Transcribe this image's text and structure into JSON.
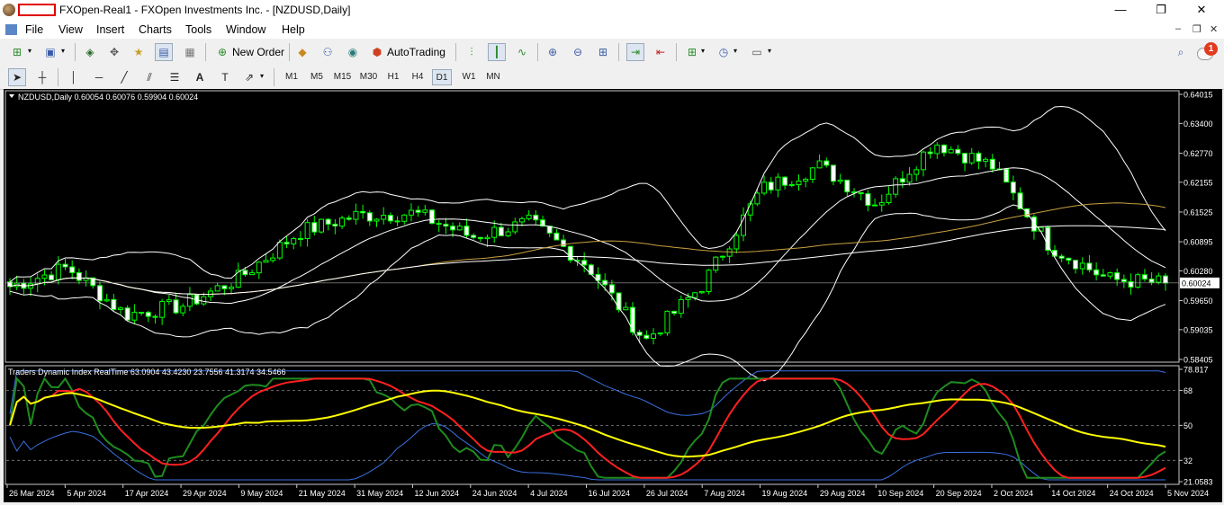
{
  "window": {
    "title": "FXOpen-Real1 - FXOpen Investments Inc. - [NZDUSD,Daily]",
    "controls": [
      "—",
      "❐",
      "✕"
    ]
  },
  "menu": {
    "items": [
      "File",
      "View",
      "Insert",
      "Charts",
      "Tools",
      "Window",
      "Help"
    ],
    "mdi_controls": [
      "–",
      "❐",
      "✕"
    ]
  },
  "toolbar": {
    "new_order_label": "New Order",
    "autotrading_label": "AutoTrading",
    "notification_count": "1"
  },
  "timeframes": [
    "M1",
    "M5",
    "M15",
    "M30",
    "H1",
    "H4",
    "D1",
    "W1",
    "MN"
  ],
  "active_timeframe": "D1",
  "chart": {
    "header": "NZDUSD,Daily  0.60054 0.60076 0.59904 0.60024",
    "current_price": "0.60024",
    "price_ticks": [
      "0.64015",
      "0.63400",
      "0.62770",
      "0.62155",
      "0.61525",
      "0.60895",
      "0.60280",
      "0.59650",
      "0.59035",
      "0.58405"
    ],
    "indicator_header": "Traders Dynamic Index RealTime 63.0904 43.4230 23.7556 41.3174 34.5466",
    "indicator_ticks": [
      "78.817",
      "68",
      "50",
      "32",
      "21.0583"
    ],
    "date_ticks": [
      "26 Mar 2024",
      "5 Apr 2024",
      "17 Apr 2024",
      "29 Apr 2024",
      "9 May 2024",
      "21 May 2024",
      "31 May 2024",
      "12 Jun 2024",
      "24 Jun 2024",
      "4 Jul 2024",
      "16 Jul 2024",
      "26 Jul 2024",
      "7 Aug 2024",
      "19 Aug 2024",
      "29 Aug 2024",
      "10 Sep 2024",
      "20 Sep 2024",
      "2 Oct 2024",
      "14 Oct 2024",
      "24 Oct 2024",
      "5 Nov 2024"
    ],
    "colors": {
      "background": "#000000",
      "candle": "#00ff00",
      "bands": "#ffffff",
      "ma_slow": "#c8a040",
      "tdi_bands": "#3a6fe0",
      "tdi_price": "#1e8c1e",
      "tdi_signal": "#ff2020",
      "tdi_base": "#ffff00"
    }
  },
  "chart_data": {
    "type": "candlestick",
    "symbol": "NZDUSD",
    "timeframe": "Daily",
    "ohlc_last": {
      "open": 0.60054,
      "high": 0.60076,
      "low": 0.59904,
      "close": 0.60024
    },
    "ylim": [
      0.58405,
      0.64015
    ],
    "x": [
      "26 Mar 2024",
      "5 Apr 2024",
      "17 Apr 2024",
      "29 Apr 2024",
      "9 May 2024",
      "21 May 2024",
      "31 May 2024",
      "12 Jun 2024",
      "24 Jun 2024",
      "4 Jul 2024",
      "16 Jul 2024",
      "26 Jul 2024",
      "7 Aug 2024",
      "19 Aug 2024",
      "29 Aug 2024",
      "10 Sep 2024",
      "20 Sep 2024",
      "2 Oct 2024",
      "14 Oct 2024",
      "24 Oct 2024",
      "5 Nov 2024"
    ],
    "close_path": [
      [
        "26 Mar 2024",
        0.5995
      ],
      [
        "5 Apr 2024",
        0.6035
      ],
      [
        "17 Apr 2024",
        0.5935
      ],
      [
        "29 Apr 2024",
        0.5955
      ],
      [
        "9 May 2024",
        0.6015
      ],
      [
        "21 May 2024",
        0.611
      ],
      [
        "31 May 2024",
        0.6145
      ],
      [
        "12 Jun 2024",
        0.615
      ],
      [
        "24 Jun 2024",
        0.61
      ],
      [
        "4 Jul 2024",
        0.613
      ],
      [
        "16 Jul 2024",
        0.604
      ],
      [
        "26 Jul 2024",
        0.588
      ],
      [
        "7 Aug 2024",
        0.6
      ],
      [
        "19 Aug 2024",
        0.62
      ],
      [
        "29 Aug 2024",
        0.625
      ],
      [
        "10 Sep 2024",
        0.617
      ],
      [
        "20 Sep 2024",
        0.63
      ],
      [
        "2 Oct 2024",
        0.625
      ],
      [
        "14 Oct 2024",
        0.608
      ],
      [
        "24 Oct 2024",
        0.601
      ],
      [
        "5 Nov 2024",
        0.6002
      ]
    ],
    "indicator": {
      "name": "Traders Dynamic Index RealTime",
      "values": [
        63.0904,
        43.423,
        23.7556,
        41.3174,
        34.5466
      ],
      "ylim": [
        21.0583,
        78.817
      ],
      "levels": [
        32,
        50,
        68
      ]
    }
  }
}
